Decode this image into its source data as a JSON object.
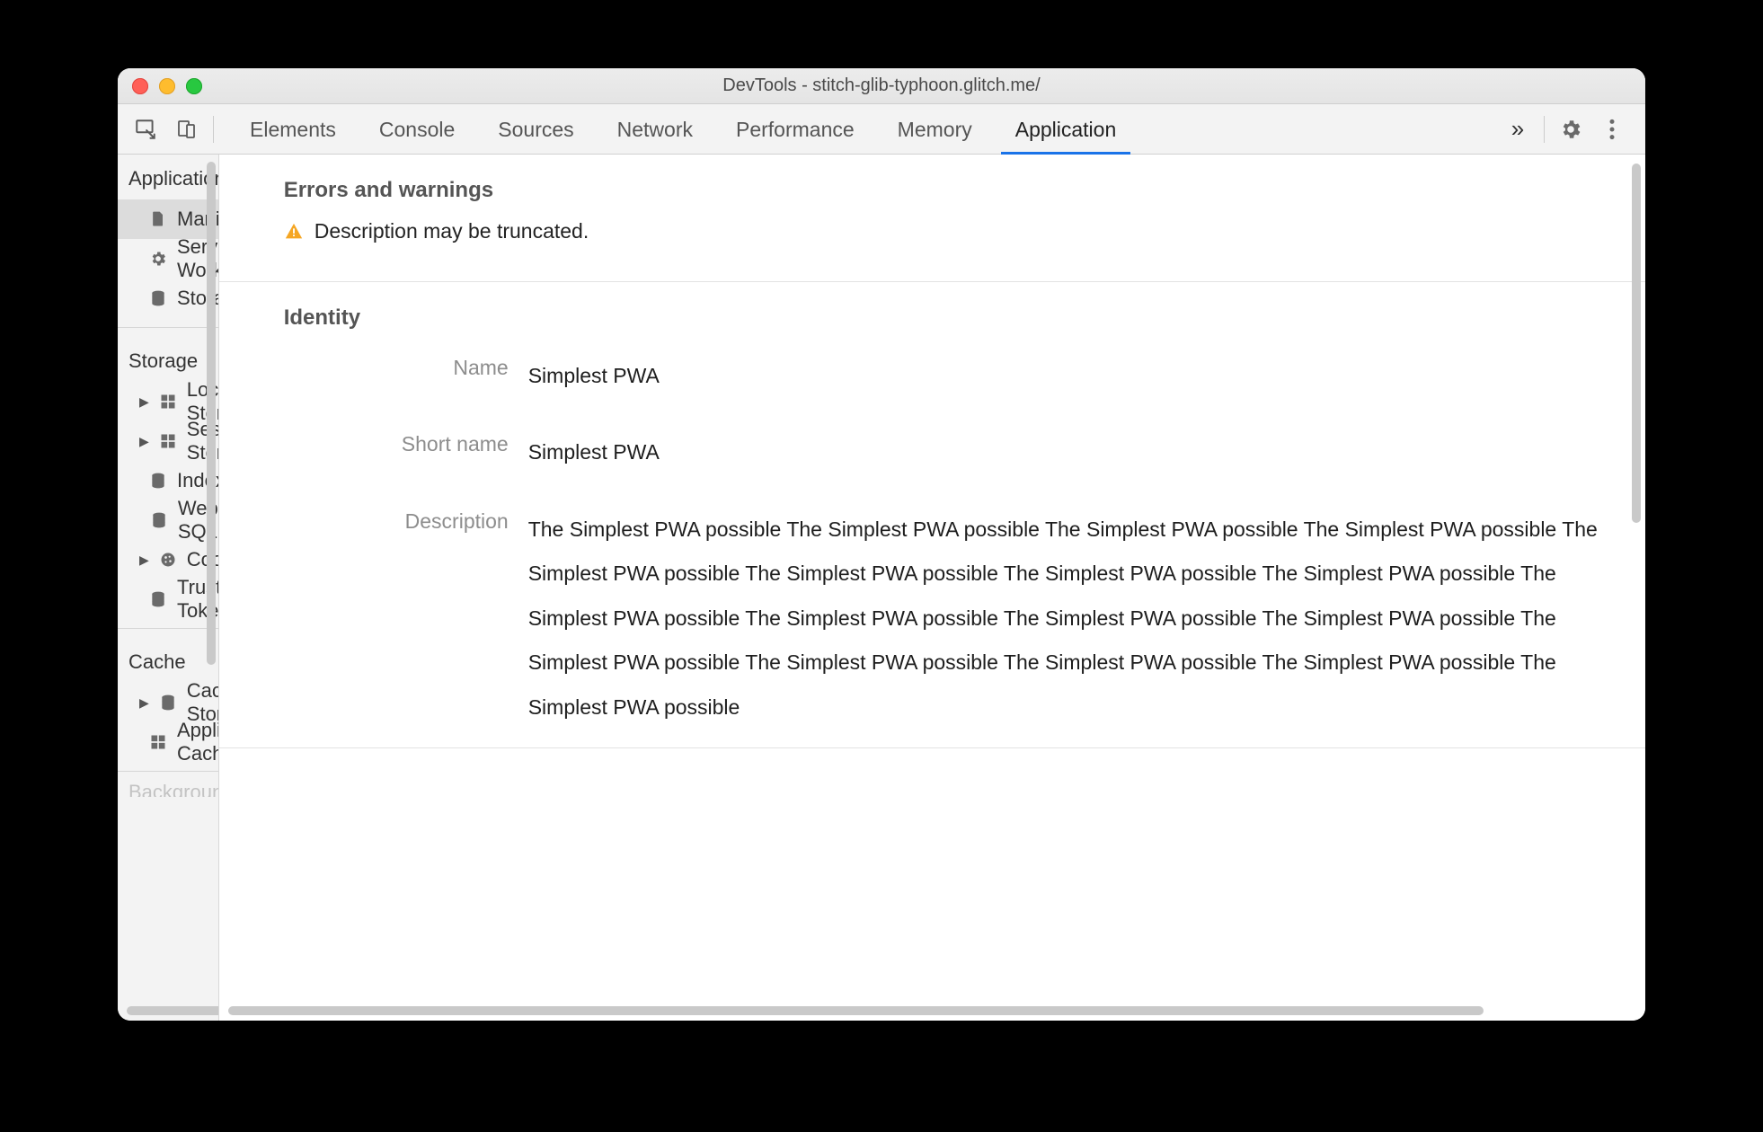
{
  "window": {
    "title": "DevTools - stitch-glib-typhoon.glitch.me/"
  },
  "toolbar": {
    "tabs": [
      "Elements",
      "Console",
      "Sources",
      "Network",
      "Performance",
      "Memory",
      "Application"
    ],
    "active_index": 6,
    "more_glyph": "»"
  },
  "sidebar": {
    "sections": [
      {
        "title": "Application",
        "items": [
          {
            "label": "Manifest",
            "icon": "file",
            "selected": true
          },
          {
            "label": "Service Workers",
            "icon": "gear"
          },
          {
            "label": "Storage",
            "icon": "db"
          }
        ]
      },
      {
        "title": "Storage",
        "items": [
          {
            "label": "Local Storage",
            "icon": "grid",
            "expandable": true
          },
          {
            "label": "Session Storage",
            "icon": "grid",
            "expandable": true
          },
          {
            "label": "IndexedDB",
            "icon": "db"
          },
          {
            "label": "Web SQL",
            "icon": "db"
          },
          {
            "label": "Cookies",
            "icon": "cookie",
            "expandable": true
          },
          {
            "label": "Trust Tokens",
            "icon": "db"
          }
        ]
      },
      {
        "title": "Cache",
        "items": [
          {
            "label": "Cache Storage",
            "icon": "db",
            "expandable": true
          },
          {
            "label": "Application Cache",
            "icon": "grid"
          }
        ]
      },
      {
        "title_cut": "Background Services"
      }
    ]
  },
  "main": {
    "errors_heading": "Errors and warnings",
    "warning_text": "Description may be truncated.",
    "identity_heading": "Identity",
    "fields": {
      "name_label": "Name",
      "name_value": "Simplest PWA",
      "short_name_label": "Short name",
      "short_name_value": "Simplest PWA",
      "description_label": "Description",
      "description_value": "The Simplest PWA possible The Simplest PWA possible The Simplest PWA possible The Simplest PWA possible The Simplest PWA possible The Simplest PWA possible The Simplest PWA possible The Simplest PWA possible The Simplest PWA possible The Simplest PWA possible The Simplest PWA possible The Simplest PWA possible The Simplest PWA possible The Simplest PWA possible The Simplest PWA possible The Simplest PWA possible The Simplest PWA possible"
    }
  }
}
